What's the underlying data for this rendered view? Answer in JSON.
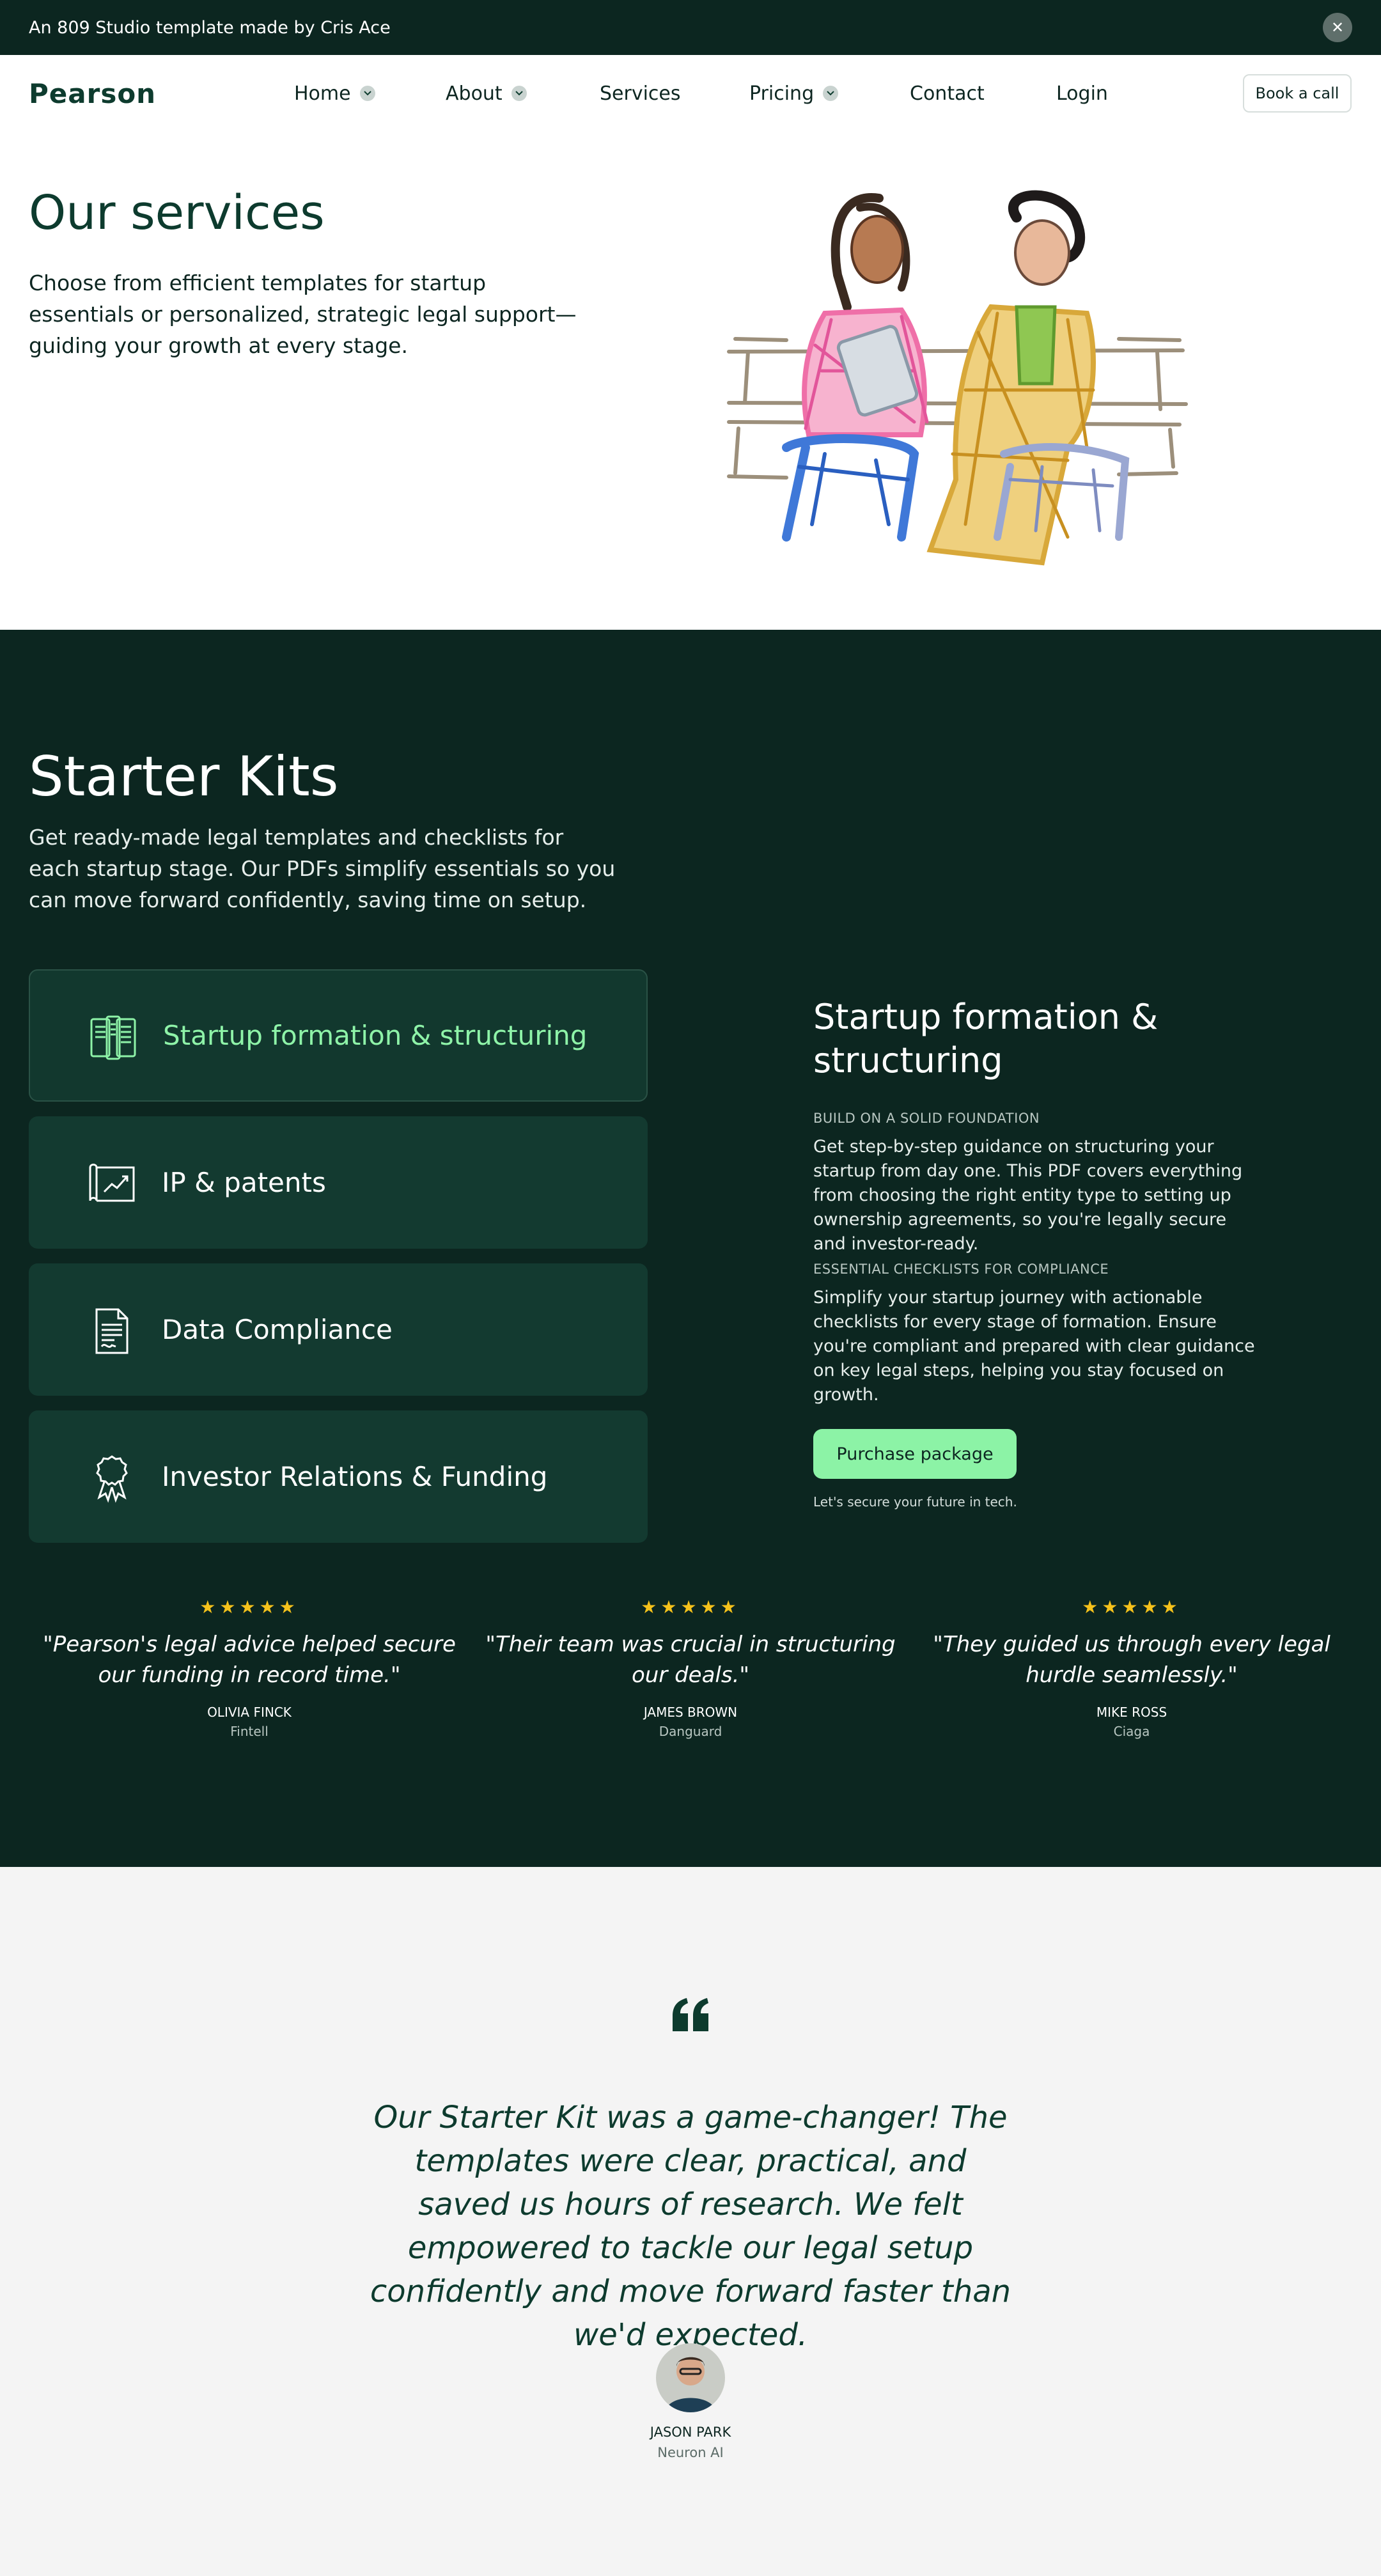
{
  "topbar": {
    "text": "An 809 Studio template made by Cris Ace",
    "close_icon": "close-icon"
  },
  "nav": {
    "logo": "Pearson",
    "items": [
      {
        "label": "Home",
        "dropdown": true
      },
      {
        "label": "About",
        "dropdown": true
      },
      {
        "label": "Services",
        "dropdown": false
      },
      {
        "label": "Pricing",
        "dropdown": true
      },
      {
        "label": "Contact",
        "dropdown": false
      },
      {
        "label": "Login",
        "dropdown": false
      }
    ],
    "cta": "Book a call"
  },
  "hero": {
    "title": "Our services",
    "description": "Choose from efficient templates for startup essentials or personalized, strategic legal support—guiding your growth at every stage."
  },
  "kits": {
    "title": "Starter Kits",
    "description": "Get ready-made legal templates and checklists for each startup stage. Our PDFs simplify essentials so you can move forward confidently, saving time on setup.",
    "items": [
      {
        "label": "Startup formation & structuring",
        "icon": "documents-icon",
        "active": true
      },
      {
        "label": "IP & patents",
        "icon": "blueprint-chart-icon",
        "active": false
      },
      {
        "label": "Data Compliance",
        "icon": "signed-document-icon",
        "active": false
      },
      {
        "label": "Investor Relations & Funding",
        "icon": "award-ribbon-icon",
        "active": false
      }
    ],
    "detail": {
      "title": "Startup formation & structuring",
      "sections": [
        {
          "heading": "Build on a solid foundation",
          "body": "Get step-by-step guidance on structuring your startup from day one. This PDF covers everything from choosing the right entity type to setting up ownership agreements, so you're legally secure and investor-ready."
        },
        {
          "heading": "Essential checklists for compliance",
          "body": "Simplify your startup journey with actionable checklists for every stage of formation. Ensure you're compliant and prepared with clear guidance on key legal steps, helping you stay focused on growth."
        }
      ],
      "button": "Purchase package",
      "tagline": "Let's secure your future in tech."
    }
  },
  "reviews": [
    {
      "stars": "★★★★★",
      "quote": "\"Pearson's legal advice helped secure our funding in record time.\"",
      "name": "Olivia Finck",
      "company": "Fintell"
    },
    {
      "stars": "★★★★★",
      "quote": "\"Their team was crucial in structuring our deals.\"",
      "name": "James Brown",
      "company": "Danguard"
    },
    {
      "stars": "★★★★★",
      "quote": "\"They guided us through every legal hurdle seamlessly.\"",
      "name": "Mike Ross",
      "company": "Ciaga"
    }
  ],
  "testimonial": {
    "quote": "Our Starter Kit was a game-changer! The templates were clear, practical, and saved us hours of research. We felt empowered to tackle our legal setup confidently and move forward faster than we'd expected.",
    "name": "Jason Park",
    "company": "Neuron AI"
  },
  "colors": {
    "dark": "#0c2620",
    "accent": "#8cf3a6",
    "card": "#133a30",
    "star": "#f6c21b",
    "light": "#f4f4f4"
  }
}
